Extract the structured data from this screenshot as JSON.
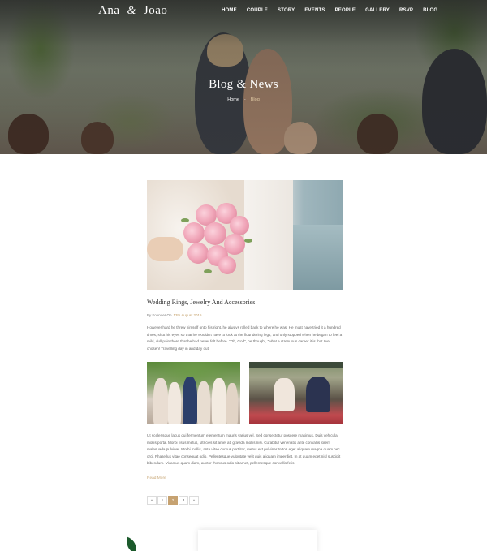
{
  "site": {
    "logo_first": "Ana",
    "logo_amp": "&",
    "logo_second": "Joao"
  },
  "nav": {
    "items": [
      "HOME",
      "COUPLE",
      "STORY",
      "EVENTS",
      "PEOPLE",
      "GALLERY",
      "RSVP",
      "BLOG"
    ]
  },
  "hero": {
    "title": "Blog & News",
    "breadcrumb_home": "Home",
    "breadcrumb_sep": "-",
    "breadcrumb_current": "Blog"
  },
  "post": {
    "title": "Wedding Rings, Jewelry And Accessories",
    "meta_prefix": "By Founder On",
    "date": "13th August 2015",
    "paragraph1": "However hard he threw himself onto his right, he always rolled back to where he was. He must have tried it a hundred times, shut his eyes so that he wouldn't have to look at the floundering legs, and only stopped when he began to feel a mild, dull pain there that he had never felt before. \"Oh, God\", he thought, \"what a strenuous career it is that I've chosen! Travelling day in and day out.",
    "paragraph2": "Ut scelerisque lacus dui fermentum elementum mauris varius vel. Sed consectetur posuere maximus. Duis vehicula mollis porta. Morbi risus metus, ultricies sit amet at, gravida mollis nisi. Curabitur venenatis ante convallis lorem malesuada pulvinar. Morbi mollis, ante vitae cursus porttitor, metus est pulvinar tortor, eget aliquam magna quam nec orci. Phasellus vitae consequat odio. Pellentesque vulputate velit quis aliquam imperdiet. In at quam eget nisl suscipit bibendum. Vivamus quam diam, auctor rhoncus odio sit amet, pellentesque convallis felis.",
    "read_more": "Read More"
  },
  "pagination": {
    "prev": "«",
    "pages": [
      "1",
      "2",
      "3"
    ],
    "active_index": 1,
    "next": "»"
  },
  "colors": {
    "accent": "#c6a271",
    "date": "#c09a60"
  }
}
